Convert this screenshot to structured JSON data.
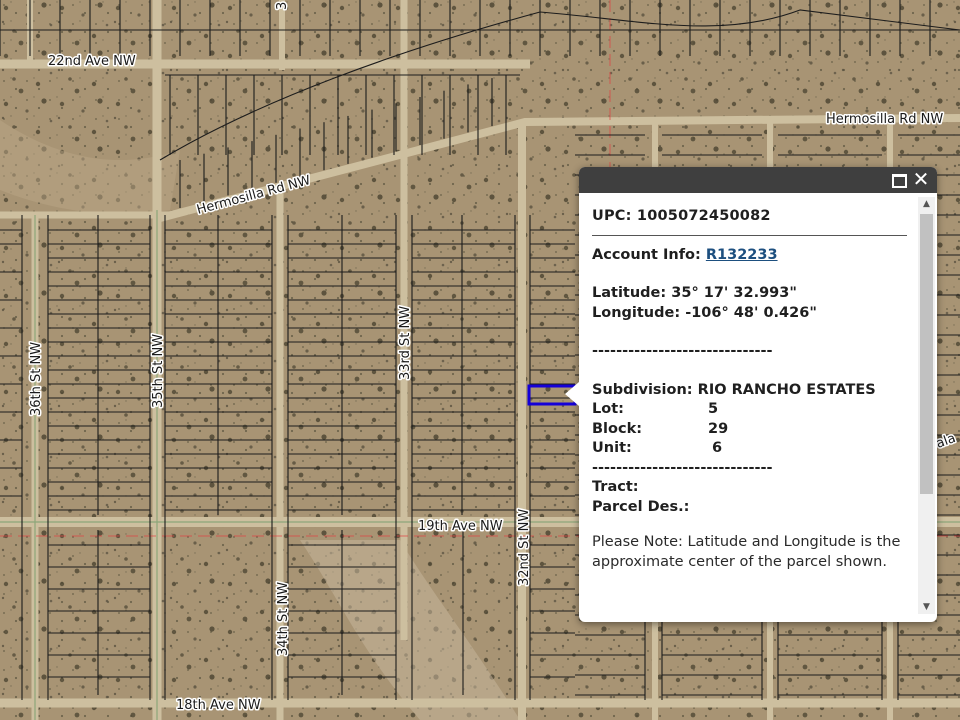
{
  "map": {
    "street_labels": {
      "ave_22nd": "22nd Ave NW",
      "hermosilla_east": "Hermosilla Rd NW",
      "hermosilla_west": "Hermosilla Rd NW",
      "st_36th": "36th St NW",
      "st_35th": "35th St NW",
      "st_33rd": "33rd St NW",
      "st_32nd": "32nd St NW",
      "st_34th": "34th St NW",
      "ave_19th": "19th Ave NW",
      "ave_18th": "18th Ave NW",
      "partial_top": "3",
      "partial_right": "ala"
    },
    "selected_parcel_color": "#1400d8",
    "parcel_line_color": "#1c1c1c",
    "imagery_color": "#a89474"
  },
  "popup": {
    "upc_label": "UPC:",
    "upc_value": "1005072450082",
    "account_label": "Account Info:",
    "account_value": "R132233",
    "latitude_label": "Latitude:",
    "latitude_value": "35° 17' 32.993\"",
    "longitude_label": "Longitude:",
    "longitude_value": "-106° 48' 0.426\"",
    "separator": "------------------------------",
    "subdivision_label": "Subdivision:",
    "subdivision_value": "RIO RANCHO ESTATES",
    "lot_label": "Lot:",
    "lot_value": "5",
    "block_label": "Block:",
    "block_value": "29",
    "unit_label": "Unit:",
    "unit_value": "6",
    "tract_label": "Tract:",
    "tract_value": "",
    "parcel_des_label": "Parcel Des.:",
    "parcel_des_value": "",
    "note": "Please Note: Latitude and Longitude is the approximate center of the parcel shown.",
    "icons": {
      "maximize": "maximize-icon",
      "close": "close-icon"
    }
  }
}
